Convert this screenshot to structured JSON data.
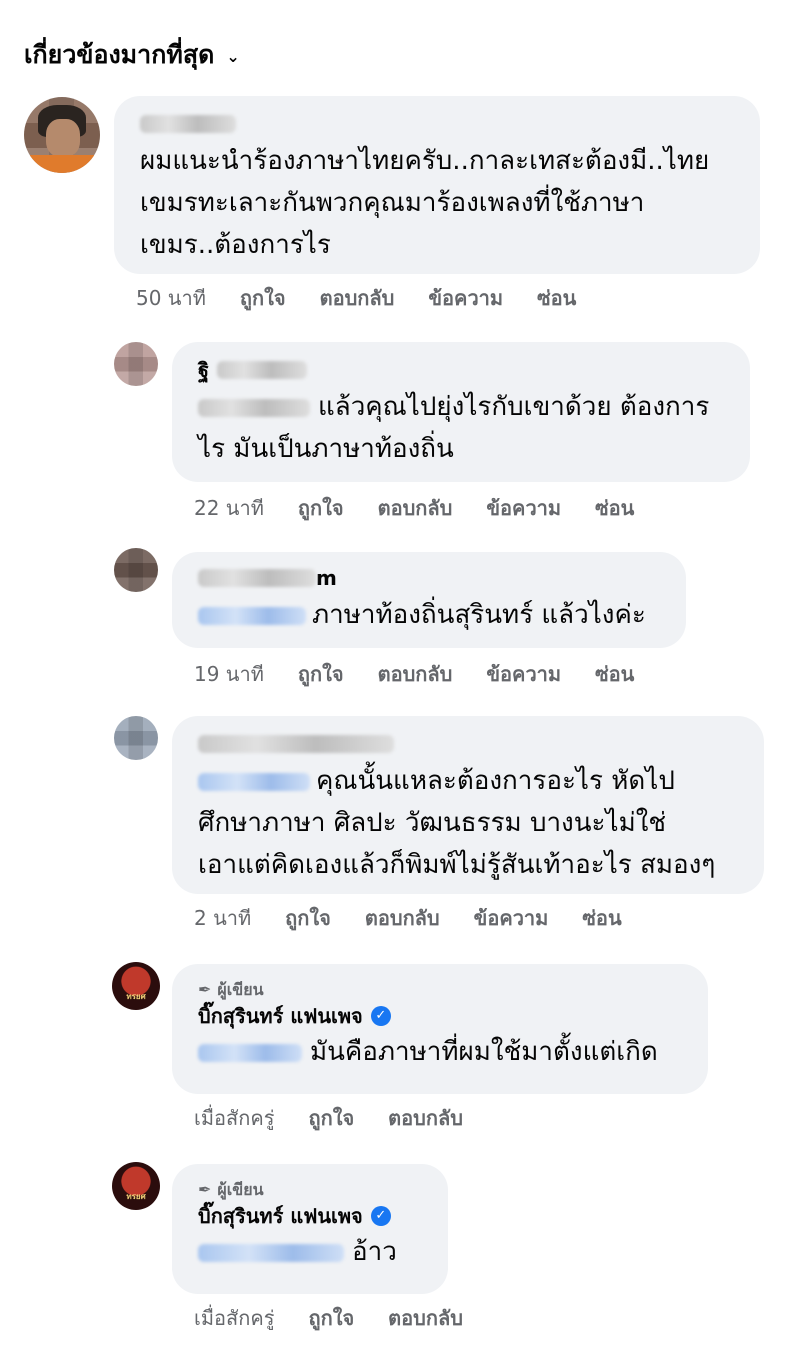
{
  "sort_label": "เกี่ยวข้องมากที่สุด",
  "icons": {
    "sort": "chevron-down-icon",
    "author": "pen-icon",
    "verified": "verified-badge-icon"
  },
  "colors": {
    "bubble": "#f0f2f5",
    "meta": "#65676b",
    "mention": "#385898",
    "verified": "#1877f2"
  },
  "comments": [
    {
      "text": "ผมแนะนำร้องภาษาไทยครับ..กาละเทสะต้องมี..ไทยเขมรทะเลาะกันพวกคุณมาร้องเพลงที่ใช้ภาษาเขมร..ต้องการไร",
      "time": "50 นาที",
      "like": "ถูกใจ",
      "reply": "ตอบกลับ",
      "message": "ข้อความ",
      "hide": "ซ่อน"
    },
    {
      "name_suffix": "ฐิ",
      "text": "แล้วคุณไปยุ่งไรกับเขาด้วย ต้องการไร มันเป็นภาษาท้องถิ่น",
      "time": "22 นาที",
      "like": "ถูกใจ",
      "reply": "ตอบกลับ",
      "message": "ข้อความ",
      "hide": "ซ่อน"
    },
    {
      "name_suffix": "m",
      "text": "ภาษาท้องถิ่นสุรินทร์ แล้วไงค่ะ",
      "time": "19 นาที",
      "like": "ถูกใจ",
      "reply": "ตอบกลับ",
      "message": "ข้อความ",
      "hide": "ซ่อน"
    },
    {
      "text_line1": "คุณนั้นแหละต้องการอะไร หัดไป",
      "text_rest": "ศึกษาภาษา ศิลปะ วัฒนธรรม บางนะไม่ใช่ เอาแต่คิดเองแล้วก็พิมพ์ไม่รู้สันเท้าอะไร สมองๆ",
      "time": "2 นาที",
      "like": "ถูกใจ",
      "reply": "ตอบกลับ",
      "message": "ข้อความ",
      "hide": "ซ่อน"
    },
    {
      "author_tag": "ผู้เขียน",
      "name": "บิ๊กสุรินทร์ แฟนเพจ",
      "avatar_label": "ทรยศ",
      "text": "มันคือภาษาที่ผมใช้มาตั้งแต่เกิด",
      "time": "เมื่อสักครู่",
      "like": "ถูกใจ",
      "reply": "ตอบกลับ"
    },
    {
      "author_tag": "ผู้เขียน",
      "name": "บิ๊กสุรินทร์ แฟนเพจ",
      "avatar_label": "ทรยศ",
      "text": "อ้าว",
      "time": "เมื่อสักครู่",
      "like": "ถูกใจ",
      "reply": "ตอบกลับ"
    }
  ]
}
